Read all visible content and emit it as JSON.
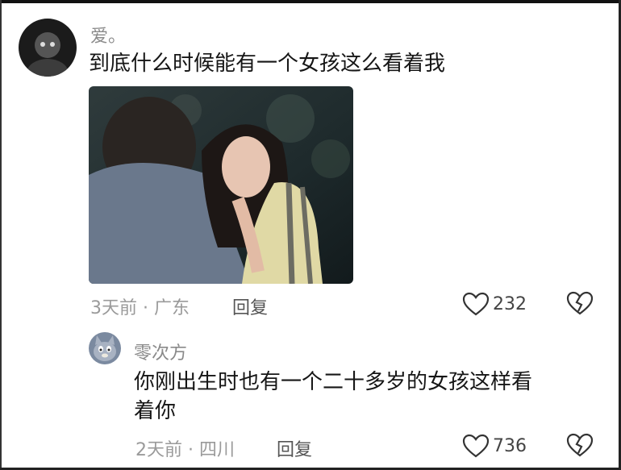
{
  "comments": [
    {
      "username": "爱。",
      "text": "到底什么时候能有一个女孩这么看着我",
      "meta": "3天前 · 广东",
      "reply_label": "回复",
      "likes": "232",
      "avatar_icon": "dark-portrait-avatar"
    },
    {
      "username": "零次方",
      "text_line1": "你刚出生时也有一个二十多岁的女孩这样看",
      "text_line2": "着你",
      "meta": "2天前 · 四川",
      "reply_label": "回复",
      "likes": "736",
      "avatar_icon": "cartoon-cat-avatar"
    }
  ],
  "icons": {
    "like": "heart-outline-icon",
    "dislike": "broken-heart-icon"
  },
  "colors": {
    "text": "#161616",
    "secondary": "#8a8a8a",
    "background": "#ffffff"
  }
}
